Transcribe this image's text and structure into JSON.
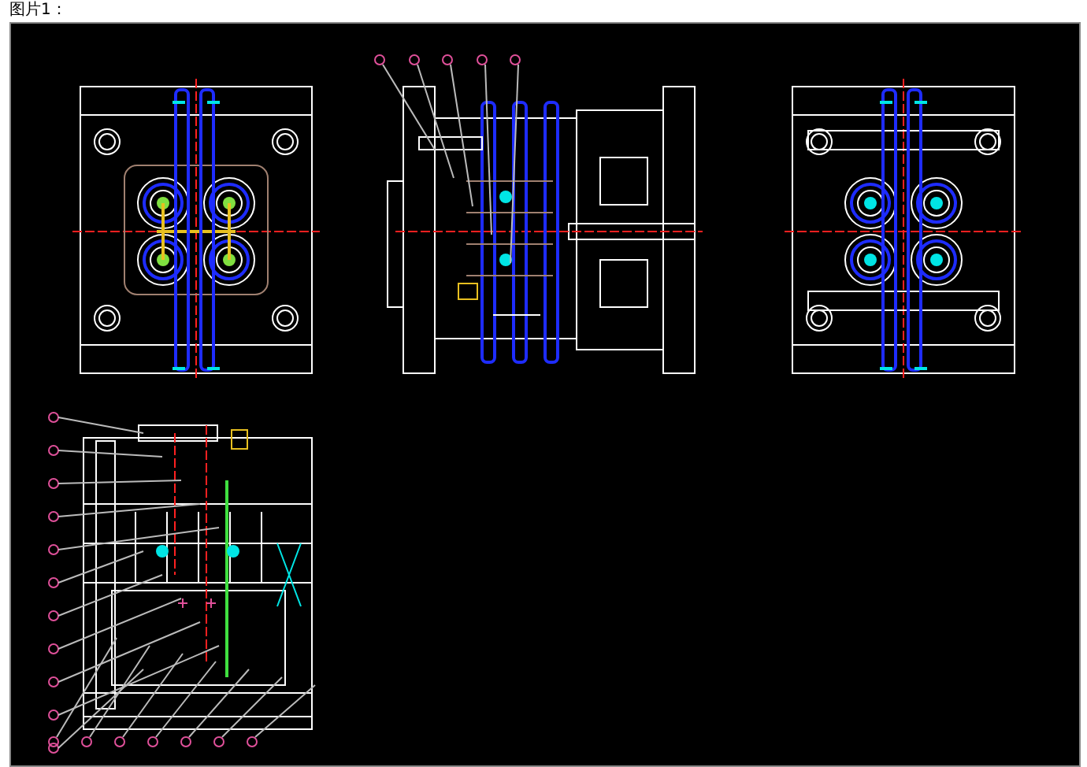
{
  "caption": "图片1：",
  "views": [
    {
      "kind": "plan"
    },
    {
      "kind": "section"
    },
    {
      "kind": "ejector-plan"
    },
    {
      "kind": "side-section"
    }
  ]
}
